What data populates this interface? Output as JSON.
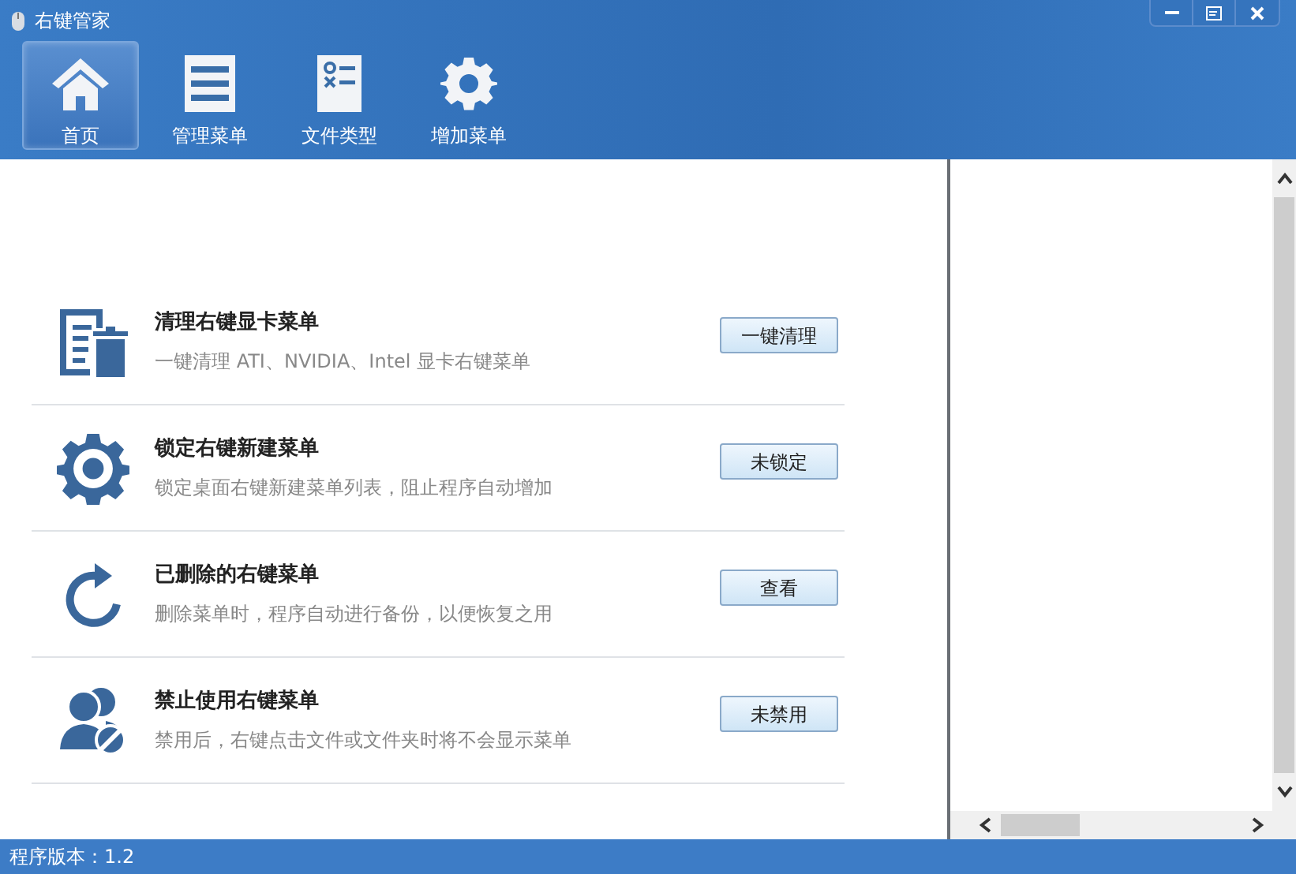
{
  "window": {
    "title": "右键管家"
  },
  "nav": [
    {
      "label": "首页",
      "kind": "home",
      "selected": true
    },
    {
      "label": "管理菜单",
      "kind": "list",
      "selected": false
    },
    {
      "label": "文件类型",
      "kind": "filetype",
      "selected": false
    },
    {
      "label": "增加菜单",
      "kind": "gear",
      "selected": false
    }
  ],
  "features": [
    {
      "kind": "clean",
      "title": "清理右键显卡菜单",
      "description": "一键清理 ATI、NVIDIA、Intel 显卡右键菜单",
      "button": "一键清理"
    },
    {
      "kind": "lock",
      "title": "锁定右键新建菜单",
      "description": "锁定桌面右键新建菜单列表，阻止程序自动增加",
      "button": "未锁定"
    },
    {
      "kind": "restore",
      "title": "已删除的右键菜单",
      "description": "删除菜单时，程序自动进行备份，以便恢复之用",
      "button": "查看"
    },
    {
      "kind": "disable",
      "title": "禁止使用右键菜单",
      "description": "禁用后，右键点击文件或文件夹时将不会显示菜单",
      "button": "未禁用"
    }
  ],
  "status_bar": {
    "version": "程序版本：1.2"
  }
}
